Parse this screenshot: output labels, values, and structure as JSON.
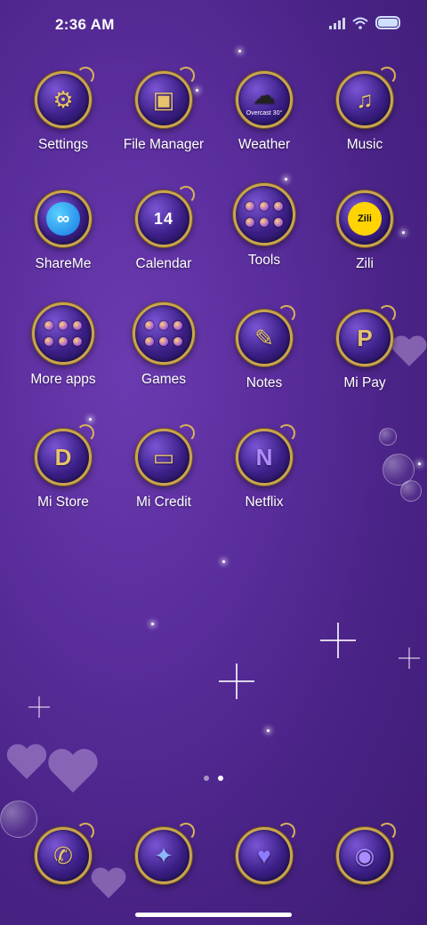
{
  "status_bar": {
    "time": "2:36 AM"
  },
  "apps": [
    {
      "label": "Settings",
      "icon": "gear-icon",
      "glyph": "⚙"
    },
    {
      "label": "File Manager",
      "icon": "folder-icon",
      "glyph": "▣"
    },
    {
      "label": "Weather",
      "icon": "cloud-icon",
      "glyph": "☁",
      "weather_text": "Overcast 30°"
    },
    {
      "label": "Music",
      "icon": "music-note-icon",
      "glyph": "♫"
    },
    {
      "label": "ShareMe",
      "icon": "shareme-icon",
      "glyph": "∞"
    },
    {
      "label": "Calendar",
      "icon": "calendar-icon",
      "glyph": "14"
    },
    {
      "label": "Tools",
      "icon": "folder-grid-icon",
      "glyph": ""
    },
    {
      "label": "Zili",
      "icon": "zili-icon",
      "glyph": "Zili"
    },
    {
      "label": "More apps",
      "icon": "folder-grid-icon",
      "glyph": ""
    },
    {
      "label": "Games",
      "icon": "folder-grid-icon",
      "glyph": ""
    },
    {
      "label": "Notes",
      "icon": "notes-icon",
      "glyph": "✎"
    },
    {
      "label": "Mi Pay",
      "icon": "mi-pay-icon",
      "glyph": "P"
    },
    {
      "label": "Mi Store",
      "icon": "mi-store-icon",
      "glyph": "D"
    },
    {
      "label": "Mi Credit",
      "icon": "credit-card-icon",
      "glyph": "▭"
    },
    {
      "label": "Netflix",
      "icon": "netflix-icon",
      "glyph": "N"
    }
  ],
  "dock": [
    {
      "icon": "phone-icon",
      "glyph": "✆"
    },
    {
      "icon": "browser-icon",
      "glyph": "✦"
    },
    {
      "icon": "messages-icon",
      "glyph": "♥"
    },
    {
      "icon": "camera-icon",
      "glyph": "◉"
    }
  ],
  "page_indicator": {
    "pages": 2,
    "active": 2
  },
  "colors": {
    "background": "#5a2d9c",
    "icon_ring": "#caa54c",
    "icon_glyph": "#e7c46a"
  }
}
